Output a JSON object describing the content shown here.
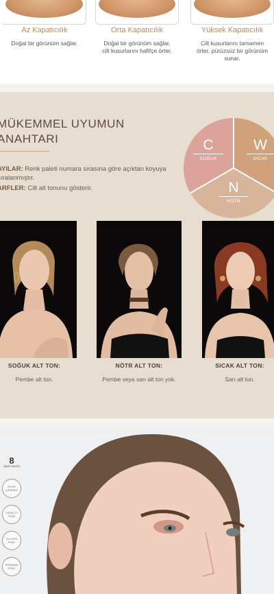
{
  "coverage": [
    {
      "title": "Az Kapatıcılık",
      "desc": "Doğal bir görünüm sağlar."
    },
    {
      "title": "Orta Kapatıcılık",
      "desc": "Doğal bir görünüm sağlar, cilt kusurlarını hafifçe örter."
    },
    {
      "title": "Yüksek Kapatıcılık",
      "desc": "Cilt kusurlarını tamamen örter, pürüzsüz bir görünüm sunar."
    }
  ],
  "match": {
    "heading_line1": "MÜKEMMEL UYUMUN",
    "heading_line2": "ANAHTARI",
    "legend_1_label": "AYILAR:",
    "legend_1_text": " Renk paleti numara sırasına göre açıktan koyuya sıralanmıştır.",
    "legend_2_label": "ARFLER:",
    "legend_2_text": " Cilt alt tonunu gösterir.",
    "wheel": {
      "c_letter": "C",
      "c_label": "SOĞUK",
      "w_letter": "W",
      "w_label": "SICAK",
      "n_letter": "N",
      "n_label": "NÖTR",
      "colors": {
        "cool": "#dba39a",
        "warm": "#d0a17a",
        "neutral": "#d8b49a"
      }
    },
    "tones": [
      {
        "title": "SOĞUK ALT TON:",
        "desc": "Pembe alt ton."
      },
      {
        "title": "NÖTR ALT TON:",
        "desc": "Pembe veya sarı alt ton yok."
      },
      {
        "title": "SICAK ALT TON:",
        "desc": "Sarı alt ton."
      }
    ]
  },
  "hero": {
    "badges": [
      {
        "main": "8",
        "sub": "SAAT KALICI"
      },
      {
        "sub": "ZEHİR İÇERMEZ"
      },
      {
        "sub": "CRUELTY FREE"
      },
      {
        "sub": "GLUTEN FREE"
      },
      {
        "sub": "PARABEN FREE"
      }
    ]
  }
}
